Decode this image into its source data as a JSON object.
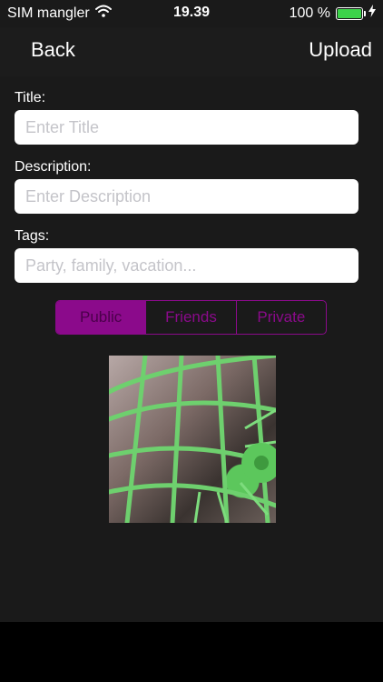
{
  "status_bar": {
    "carrier": "SIM mangler",
    "time": "19.39",
    "battery_percent": "100 %",
    "battery_level": 1.0,
    "icons": [
      "wifi-icon",
      "battery-icon",
      "charging-bolt-icon"
    ]
  },
  "nav": {
    "back_label": "Back",
    "upload_label": "Upload"
  },
  "form": {
    "title": {
      "label": "Title:",
      "placeholder": "Enter Title",
      "value": ""
    },
    "description": {
      "label": "Description:",
      "placeholder": "Enter Description",
      "value": ""
    },
    "tags": {
      "label": "Tags:",
      "placeholder": "Party, family, vacation...",
      "value": ""
    }
  },
  "visibility": {
    "options": [
      "Public",
      "Friends",
      "Private"
    ],
    "selected": "Public",
    "accent_color": "#8b0a8b"
  },
  "photo": {
    "icon": "photo-thumbnail"
  }
}
